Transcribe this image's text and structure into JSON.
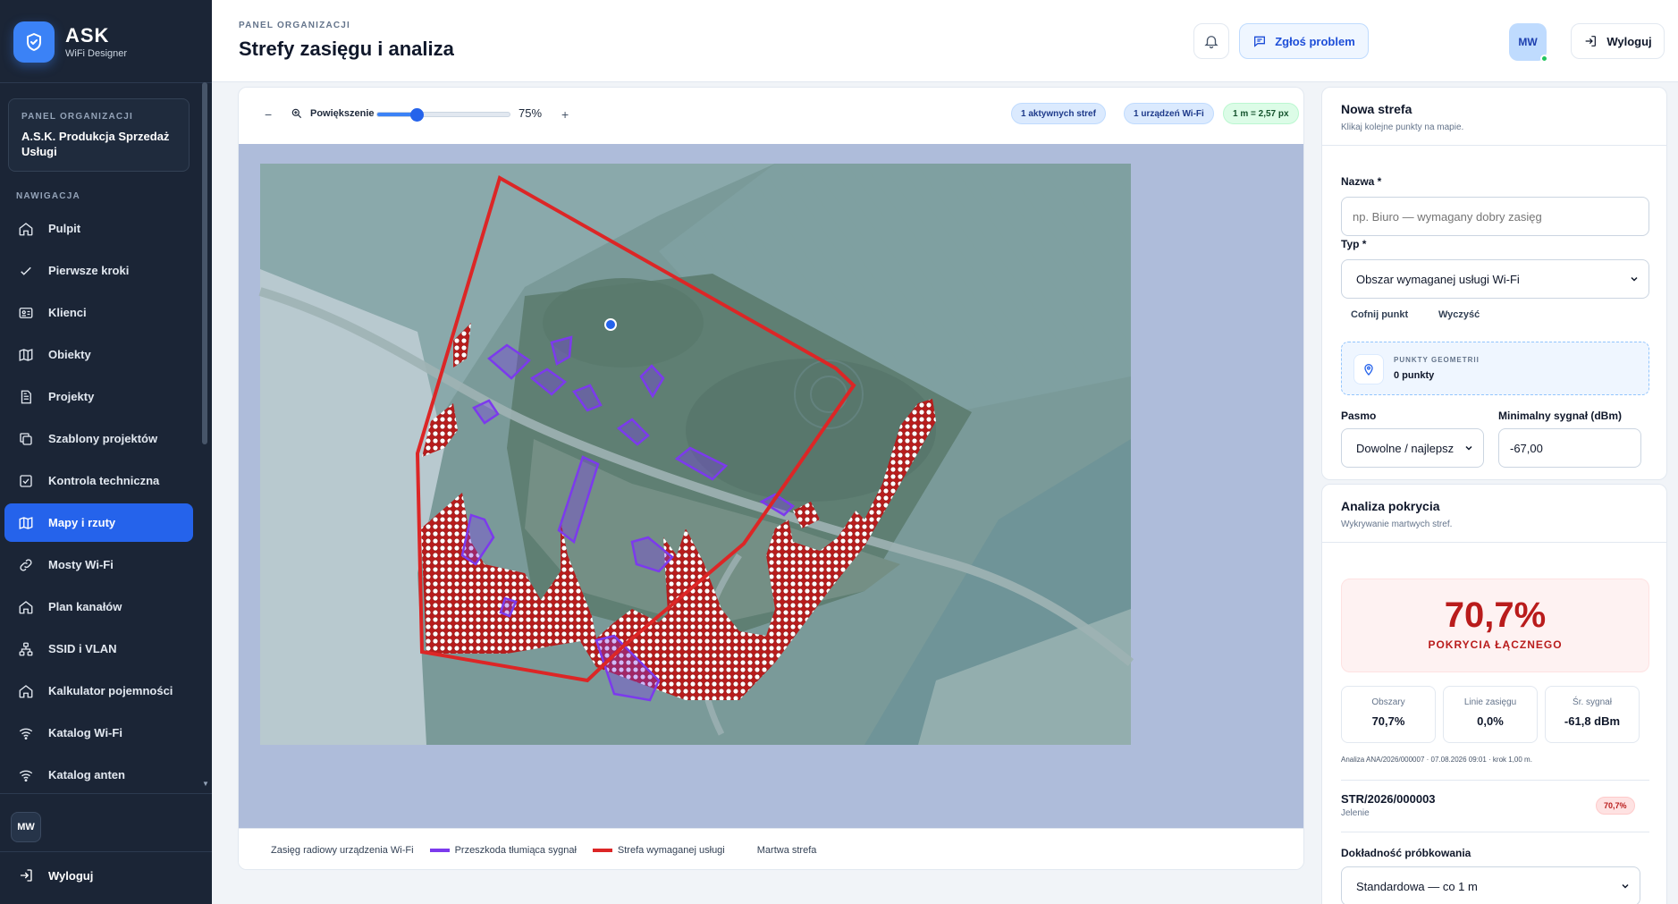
{
  "brand": {
    "name": "ASK",
    "subtitle": "WiFi Designer"
  },
  "org": {
    "label": "PANEL ORGANIZACJI",
    "name": "A.S.K. Produkcja Sprzedaż Usługi"
  },
  "nav": {
    "section_label": "NAWIGACJA",
    "items": [
      {
        "label": "Pulpit",
        "icon": "home-icon"
      },
      {
        "label": "Pierwsze kroki",
        "icon": "check-icon"
      },
      {
        "label": "Klienci",
        "icon": "id-card-icon"
      },
      {
        "label": "Obiekty",
        "icon": "map-icon"
      },
      {
        "label": "Projekty",
        "icon": "document-icon"
      },
      {
        "label": "Szablony projektów",
        "icon": "copy-icon"
      },
      {
        "label": "Kontrola techniczna",
        "icon": "checkbox-icon"
      },
      {
        "label": "Mapy i rzuty",
        "icon": "map-icon",
        "active": true
      },
      {
        "label": "Mosty Wi-Fi",
        "icon": "link-icon"
      },
      {
        "label": "Plan kanałów",
        "icon": "home-icon"
      },
      {
        "label": "SSID i VLAN",
        "icon": "network-icon"
      },
      {
        "label": "Kalkulator pojemności",
        "icon": "home-icon"
      },
      {
        "label": "Katalog Wi-Fi",
        "icon": "wifi-icon"
      },
      {
        "label": "Katalog anten",
        "icon": "wifi-icon"
      }
    ]
  },
  "sidebar_footer": {
    "avatar": "MW",
    "logout": "Wyloguj"
  },
  "header": {
    "label": "PANEL ORGANIZACJI",
    "title": "Strefy zasięgu i analiza",
    "report_button": "Zgłoś problem",
    "avatar": "MW",
    "logout_button": "Wyloguj"
  },
  "toolbar": {
    "zoom_minus": "−",
    "zoom_label": "Powiększenie",
    "zoom_value": "75%",
    "zoom_fraction": 0.3,
    "zoom_plus": "+",
    "badge_zones": "1 aktywnych stref",
    "badge_devices": "1 urządzeń Wi-Fi",
    "badge_scale": "1 m = 2,57 px"
  },
  "legend": {
    "device_range": "Zasięg radiowy urządzenia Wi-Fi",
    "obstacle": "Przeszkoda tłumiąca sygnał",
    "service_zone": "Strefa wymaganej usługi",
    "dead_zone": "Martwa strefa"
  },
  "colors": {
    "obstacle": "#7c3aed",
    "service_zone": "#dc2626",
    "accent": "#2563eb"
  },
  "new_zone": {
    "title": "Nowa strefa",
    "subtitle": "Klikaj kolejne punkty na mapie.",
    "name_label": "Nazwa *",
    "name_placeholder": "np. Biuro — wymagany dobry zasięg",
    "type_label": "Typ *",
    "type_value": "Obszar wymaganej usługi Wi-Fi",
    "undo_point": "Cofnij punkt",
    "clear": "Wyczyść",
    "geometry_label": "PUNKTY GEOMETRII",
    "geometry_value": "0 punkty",
    "band_label": "Pasmo",
    "band_value": "Dowolne / najlepsz",
    "min_signal_label": "Minimalny sygnał (dBm)",
    "min_signal_value": "-67,00"
  },
  "analysis": {
    "title": "Analiza pokrycia",
    "subtitle": "Wykrywanie martwych stref.",
    "coverage_value": "70,7%",
    "coverage_label": "POKRYCIA ŁĄCZNEGO",
    "stats": [
      {
        "label": "Obszary",
        "value": "70,7%"
      },
      {
        "label": "Linie zasięgu",
        "value": "0,0%"
      },
      {
        "label": "Śr. sygnał",
        "value": "-61,8 dBm"
      }
    ],
    "meta": "Analiza ANA/2026/000007 · 07.08.2026 09:01 · krok 1,00 m.",
    "zone_id": "STR/2026/000003",
    "zone_location": "Jelenie",
    "zone_coverage": "70,7%",
    "accuracy_label": "Dokładność próbkowania",
    "accuracy_value": "Standardowa — co 1 m"
  }
}
